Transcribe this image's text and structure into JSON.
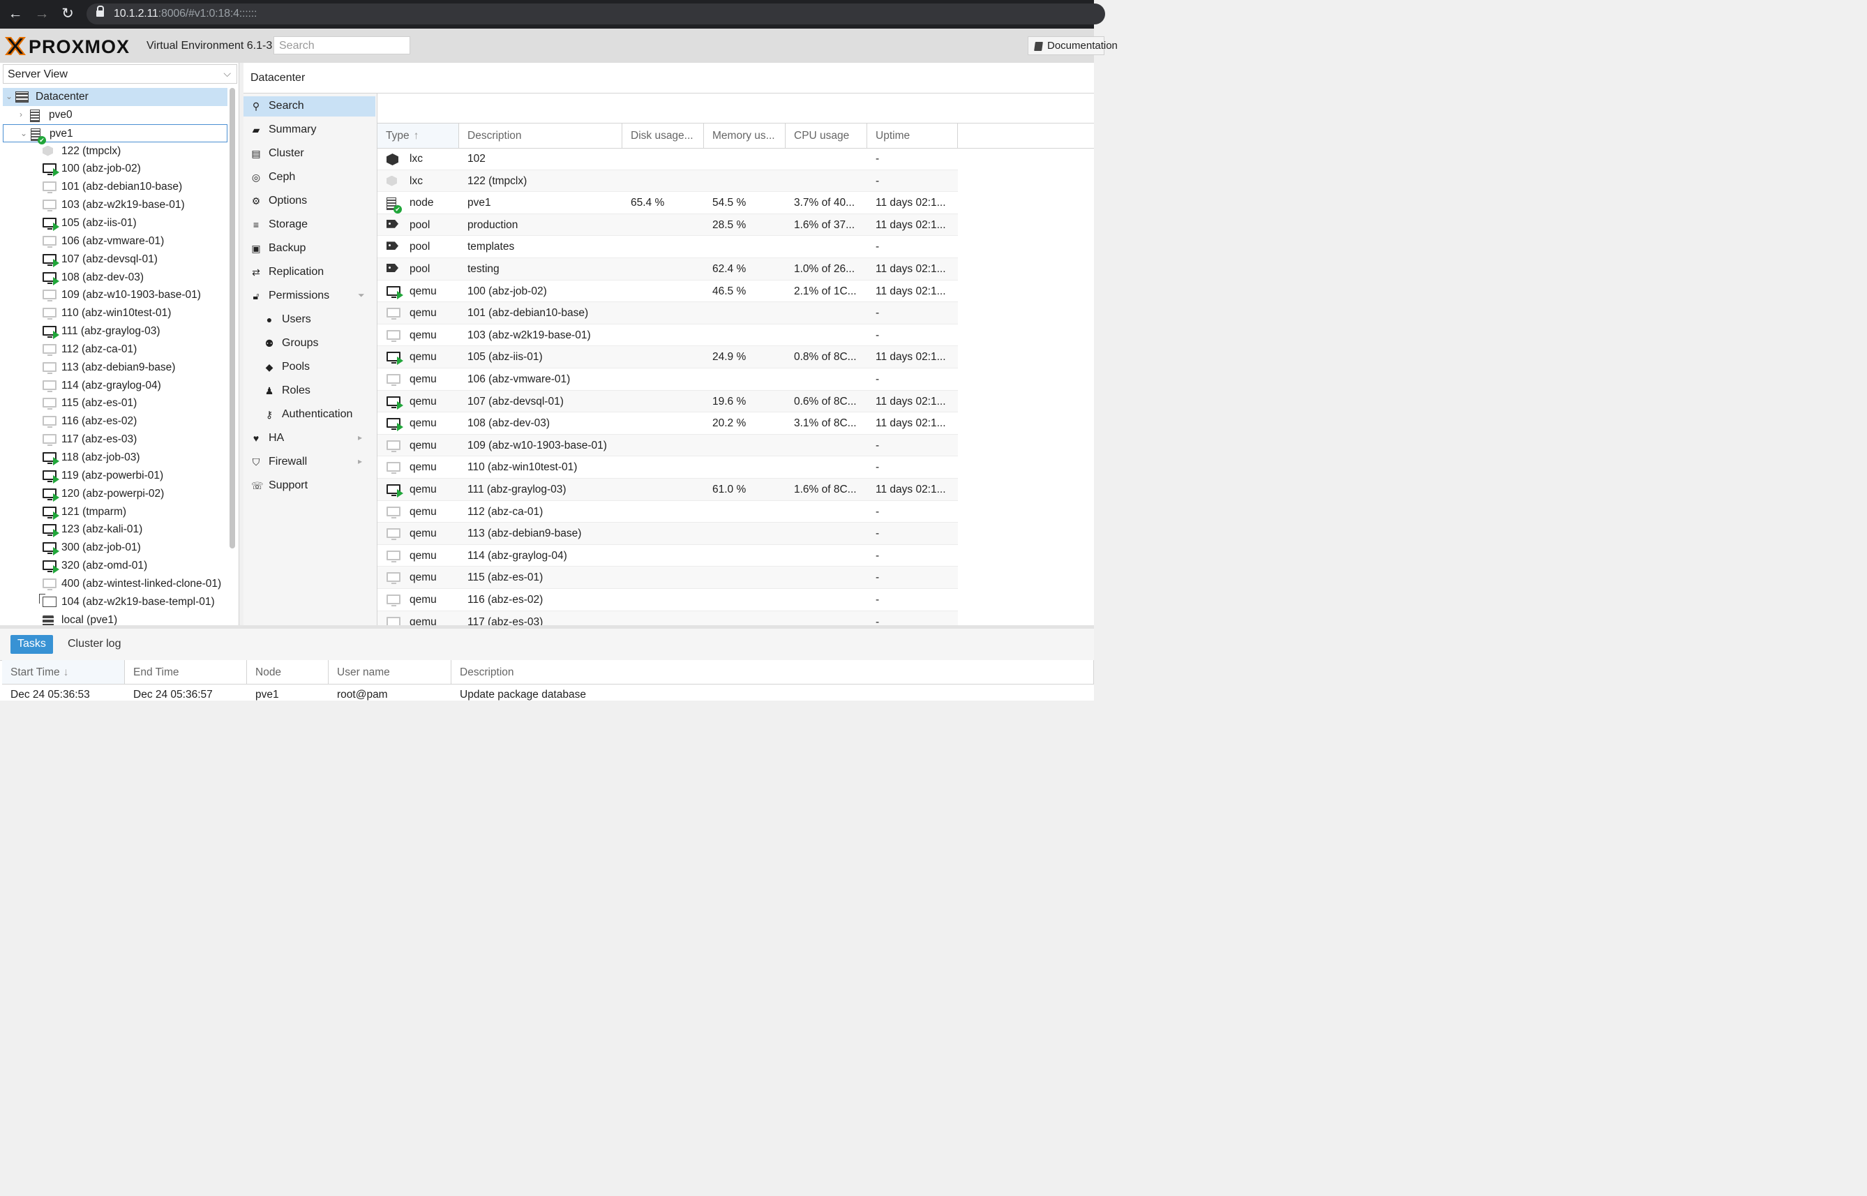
{
  "browser": {
    "url_host": "10.1.2.11",
    "url_rest": ":8006/#v1:0:18:4::::::"
  },
  "header": {
    "logo_text": "PROXMOX",
    "version": "Virtual Environment 6.1-3",
    "search_placeholder": "Search",
    "documentation_label": "Documentation"
  },
  "left": {
    "view_selector": "Server View",
    "tree": [
      {
        "label": "Datacenter",
        "icon": "datacenter-icon",
        "indent": 0,
        "expander": "down"
      },
      {
        "label": "pve0",
        "icon": "node-icon",
        "indent": 1,
        "expander": "right"
      },
      {
        "label": "pve1",
        "icon": "node-online-icon",
        "indent": 1,
        "expander": "down"
      },
      {
        "label": "122 (tmpclx)",
        "icon": "container-stopped-icon",
        "indent": 2
      },
      {
        "label": "100 (abz-job-02)",
        "icon": "vm-running-icon",
        "indent": 2
      },
      {
        "label": "101 (abz-debian10-base)",
        "icon": "vm-stopped-icon",
        "indent": 2
      },
      {
        "label": "103 (abz-w2k19-base-01)",
        "icon": "vm-stopped-icon",
        "indent": 2
      },
      {
        "label": "105 (abz-iis-01)",
        "icon": "vm-running-icon",
        "indent": 2
      },
      {
        "label": "106 (abz-vmware-01)",
        "icon": "vm-stopped-icon",
        "indent": 2
      },
      {
        "label": "107 (abz-devsql-01)",
        "icon": "vm-running-icon",
        "indent": 2
      },
      {
        "label": "108 (abz-dev-03)",
        "icon": "vm-running-icon",
        "indent": 2
      },
      {
        "label": "109 (abz-w10-1903-base-01)",
        "icon": "vm-stopped-icon",
        "indent": 2
      },
      {
        "label": "110 (abz-win10test-01)",
        "icon": "vm-stopped-icon",
        "indent": 2
      },
      {
        "label": "111 (abz-graylog-03)",
        "icon": "vm-running-icon",
        "indent": 2
      },
      {
        "label": "112 (abz-ca-01)",
        "icon": "vm-stopped-icon",
        "indent": 2
      },
      {
        "label": "113 (abz-debian9-base)",
        "icon": "vm-stopped-icon",
        "indent": 2
      },
      {
        "label": "114 (abz-graylog-04)",
        "icon": "vm-stopped-icon",
        "indent": 2
      },
      {
        "label": "115 (abz-es-01)",
        "icon": "vm-stopped-icon",
        "indent": 2
      },
      {
        "label": "116 (abz-es-02)",
        "icon": "vm-stopped-icon",
        "indent": 2
      },
      {
        "label": "117 (abz-es-03)",
        "icon": "vm-stopped-icon",
        "indent": 2
      },
      {
        "label": "118 (abz-job-03)",
        "icon": "vm-running-icon",
        "indent": 2
      },
      {
        "label": "119 (abz-powerbi-01)",
        "icon": "vm-running-icon",
        "indent": 2
      },
      {
        "label": "120 (abz-powerpi-02)",
        "icon": "vm-running-icon",
        "indent": 2
      },
      {
        "label": "121 (tmparm)",
        "icon": "vm-running-icon",
        "indent": 2
      },
      {
        "label": "123 (abz-kali-01)",
        "icon": "vm-running-icon",
        "indent": 2
      },
      {
        "label": "300 (abz-job-01)",
        "icon": "vm-running-icon",
        "indent": 2
      },
      {
        "label": "320 (abz-omd-01)",
        "icon": "vm-running-icon",
        "indent": 2
      },
      {
        "label": "400 (abz-wintest-linked-clone-01)",
        "icon": "vm-stopped-icon",
        "indent": 2
      },
      {
        "label": "104 (abz-w2k19-base-templ-01)",
        "icon": "template-icon",
        "indent": 2
      },
      {
        "label": "local (pve1)",
        "icon": "storage-icon",
        "indent": 2
      }
    ]
  },
  "content": {
    "title": "Datacenter",
    "menu": [
      {
        "label": "Search",
        "icon": "search-icon",
        "glyph": "⚲",
        "sub": false
      },
      {
        "label": "Summary",
        "icon": "book-icon",
        "glyph": "▰",
        "sub": false
      },
      {
        "label": "Cluster",
        "icon": "server-icon",
        "glyph": "▤",
        "sub": false
      },
      {
        "label": "Ceph",
        "icon": "ceph-icon",
        "glyph": "◎",
        "sub": false
      },
      {
        "label": "Options",
        "icon": "gear-icon",
        "glyph": "⚙",
        "sub": false
      },
      {
        "label": "Storage",
        "icon": "database-icon",
        "glyph": "≡",
        "sub": false
      },
      {
        "label": "Backup",
        "icon": "floppy-icon",
        "glyph": "▣",
        "sub": false
      },
      {
        "label": "Replication",
        "icon": "retweet-icon",
        "glyph": "⇄",
        "sub": false
      },
      {
        "label": "Permissions",
        "icon": "unlock-icon",
        "glyph": "🔓︎",
        "sub": false,
        "arrow": "⏷"
      },
      {
        "label": "Users",
        "icon": "user-icon",
        "glyph": "●",
        "sub": true
      },
      {
        "label": "Groups",
        "icon": "users-icon",
        "glyph": "⚉",
        "sub": true
      },
      {
        "label": "Pools",
        "icon": "tags-icon",
        "glyph": "◆",
        "sub": true
      },
      {
        "label": "Roles",
        "icon": "male-icon",
        "glyph": "♟",
        "sub": true
      },
      {
        "label": "Authentication",
        "icon": "key-icon",
        "glyph": "⚷",
        "sub": true
      },
      {
        "label": "HA",
        "icon": "heartbeat-icon",
        "glyph": "♥",
        "sub": false,
        "arrow": "▸"
      },
      {
        "label": "Firewall",
        "icon": "shield-icon",
        "glyph": "⛉",
        "sub": false,
        "arrow": "▸"
      },
      {
        "label": "Support",
        "icon": "comments-icon",
        "glyph": "☏",
        "sub": false
      }
    ],
    "grid": {
      "columns": [
        "Type",
        "Description",
        "Disk usage...",
        "Memory us...",
        "CPU usage",
        "Uptime"
      ],
      "sort_indicator": "↑",
      "rows": [
        {
          "type": "lxc",
          "icon": "container-running-icon",
          "description": "102",
          "disk": "",
          "memory": "",
          "cpu": "",
          "uptime": "-"
        },
        {
          "type": "lxc",
          "icon": "container-stopped-icon",
          "description": "122 (tmpclx)",
          "disk": "",
          "memory": "",
          "cpu": "",
          "uptime": "-"
        },
        {
          "type": "node",
          "icon": "node-online-icon",
          "description": "pve1",
          "disk": "65.4 %",
          "memory": "54.5 %",
          "cpu": "3.7% of 40...",
          "uptime": "11 days 02:1..."
        },
        {
          "type": "pool",
          "icon": "tags-icon",
          "description": "production",
          "disk": "",
          "memory": "28.5 %",
          "cpu": "1.6% of 37...",
          "uptime": "11 days 02:1..."
        },
        {
          "type": "pool",
          "icon": "tags-icon",
          "description": "templates",
          "disk": "",
          "memory": "",
          "cpu": "",
          "uptime": "-"
        },
        {
          "type": "pool",
          "icon": "tags-icon",
          "description": "testing",
          "disk": "",
          "memory": "62.4 %",
          "cpu": "1.0% of 26...",
          "uptime": "11 days 02:1..."
        },
        {
          "type": "qemu",
          "icon": "vm-running-icon",
          "description": "100 (abz-job-02)",
          "disk": "",
          "memory": "46.5 %",
          "cpu": "2.1% of 1C...",
          "uptime": "11 days 02:1..."
        },
        {
          "type": "qemu",
          "icon": "vm-stopped-icon",
          "description": "101 (abz-debian10-base)",
          "disk": "",
          "memory": "",
          "cpu": "",
          "uptime": "-"
        },
        {
          "type": "qemu",
          "icon": "vm-stopped-icon",
          "description": "103 (abz-w2k19-base-01)",
          "disk": "",
          "memory": "",
          "cpu": "",
          "uptime": "-"
        },
        {
          "type": "qemu",
          "icon": "vm-running-icon",
          "description": "105 (abz-iis-01)",
          "disk": "",
          "memory": "24.9 %",
          "cpu": "0.8% of 8C...",
          "uptime": "11 days 02:1..."
        },
        {
          "type": "qemu",
          "icon": "vm-stopped-icon",
          "description": "106 (abz-vmware-01)",
          "disk": "",
          "memory": "",
          "cpu": "",
          "uptime": "-"
        },
        {
          "type": "qemu",
          "icon": "vm-running-icon",
          "description": "107 (abz-devsql-01)",
          "disk": "",
          "memory": "19.6 %",
          "cpu": "0.6% of 8C...",
          "uptime": "11 days 02:1..."
        },
        {
          "type": "qemu",
          "icon": "vm-running-icon",
          "description": "108 (abz-dev-03)",
          "disk": "",
          "memory": "20.2 %",
          "cpu": "3.1% of 8C...",
          "uptime": "11 days 02:1..."
        },
        {
          "type": "qemu",
          "icon": "vm-stopped-icon",
          "description": "109 (abz-w10-1903-base-01)",
          "disk": "",
          "memory": "",
          "cpu": "",
          "uptime": "-"
        },
        {
          "type": "qemu",
          "icon": "vm-stopped-icon",
          "description": "110 (abz-win10test-01)",
          "disk": "",
          "memory": "",
          "cpu": "",
          "uptime": "-"
        },
        {
          "type": "qemu",
          "icon": "vm-running-icon",
          "description": "111 (abz-graylog-03)",
          "disk": "",
          "memory": "61.0 %",
          "cpu": "1.6% of 8C...",
          "uptime": "11 days 02:1..."
        },
        {
          "type": "qemu",
          "icon": "vm-stopped-icon",
          "description": "112 (abz-ca-01)",
          "disk": "",
          "memory": "",
          "cpu": "",
          "uptime": "-"
        },
        {
          "type": "qemu",
          "icon": "vm-stopped-icon",
          "description": "113 (abz-debian9-base)",
          "disk": "",
          "memory": "",
          "cpu": "",
          "uptime": "-"
        },
        {
          "type": "qemu",
          "icon": "vm-stopped-icon",
          "description": "114 (abz-graylog-04)",
          "disk": "",
          "memory": "",
          "cpu": "",
          "uptime": "-"
        },
        {
          "type": "qemu",
          "icon": "vm-stopped-icon",
          "description": "115 (abz-es-01)",
          "disk": "",
          "memory": "",
          "cpu": "",
          "uptime": "-"
        },
        {
          "type": "qemu",
          "icon": "vm-stopped-icon",
          "description": "116 (abz-es-02)",
          "disk": "",
          "memory": "",
          "cpu": "",
          "uptime": "-"
        },
        {
          "type": "qemu",
          "icon": "vm-stopped-icon",
          "description": "117 (abz-es-03)",
          "disk": "",
          "memory": "",
          "cpu": "",
          "uptime": "-"
        }
      ]
    }
  },
  "bottom": {
    "tabs": [
      "Tasks",
      "Cluster log"
    ],
    "columns": [
      "Start Time",
      "End Time",
      "Node",
      "User name",
      "Description"
    ],
    "sort_indicator": "↓",
    "rows": [
      {
        "start": "Dec 24 05:36:53",
        "end": "Dec 24 05:36:57",
        "node": "pve1",
        "user": "root@pam",
        "description": "Update package database"
      }
    ]
  },
  "colors": {
    "selection": "#c9e1f5",
    "accent": "#3892d4",
    "running": "#21a63a",
    "logo_orange": "#e57000"
  }
}
